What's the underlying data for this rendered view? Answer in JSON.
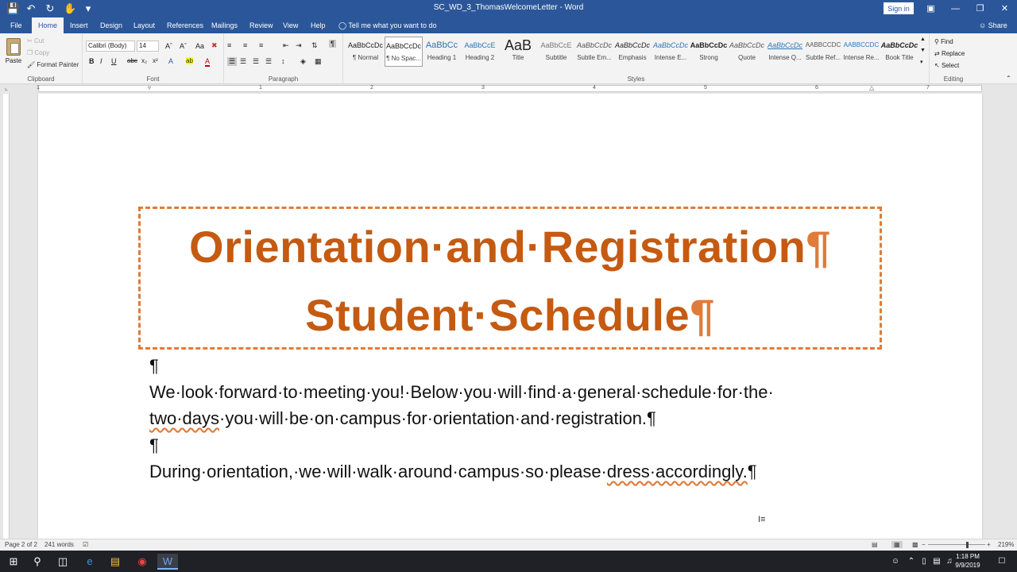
{
  "window": {
    "title": "SC_WD_3_ThomasWelcomeLetter - Word",
    "signin_label": "Sign in",
    "qat_icons": [
      "save-icon",
      "undo-icon",
      "redo-icon",
      "touch-mode-icon",
      "customize-qat-icon"
    ],
    "controls": [
      "ribbon-display-icon",
      "minimize-icon",
      "restore-icon",
      "close-icon"
    ]
  },
  "tabs": [
    "File",
    "Home",
    "Insert",
    "Design",
    "Layout",
    "References",
    "Mailings",
    "Review",
    "View",
    "Help"
  ],
  "active_tab": "Home",
  "tell_me": "Tell me what you want to do",
  "share_label": "Share",
  "ribbon": {
    "clipboard": {
      "label": "Clipboard",
      "paste": "Paste",
      "cut": "Cut",
      "copy": "Copy",
      "format_painter": "Format Painter"
    },
    "font": {
      "label": "Font",
      "font_name": "Calibri (Body)",
      "font_size": "14",
      "format_buttons": [
        "B",
        "I",
        "U"
      ]
    },
    "paragraph": {
      "label": "Paragraph"
    },
    "styles": {
      "label": "Styles",
      "items": [
        {
          "preview": "AaBbCcDc",
          "name": "¶ Normal"
        },
        {
          "preview": "AaBbCcDc",
          "name": "¶ No Spac..."
        },
        {
          "preview": "AaBbCc",
          "name": "Heading 1"
        },
        {
          "preview": "AaBbCcE",
          "name": "Heading 2"
        },
        {
          "preview": "AaB",
          "name": "Title"
        },
        {
          "preview": "AaBbCcE",
          "name": "Subtitle"
        },
        {
          "preview": "AaBbCcDc",
          "name": "Subtle Em..."
        },
        {
          "preview": "AaBbCcDc",
          "name": "Emphasis"
        },
        {
          "preview": "AaBbCcDc",
          "name": "Intense E..."
        },
        {
          "preview": "AaBbCcDc",
          "name": "Strong"
        },
        {
          "preview": "AaBbCcDc",
          "name": "Quote"
        },
        {
          "preview": "AaBbCcDc",
          "name": "Intense Q..."
        },
        {
          "preview": "AABBCCDC",
          "name": "Subtle Ref..."
        },
        {
          "preview": "AABBCCDC",
          "name": "Intense Re..."
        },
        {
          "preview": "AaBbCcDc",
          "name": "Book Title"
        }
      ]
    },
    "editing": {
      "label": "Editing",
      "find": "Find",
      "replace": "Replace",
      "select": "Select"
    }
  },
  "ruler_numbers": [
    "1",
    "1",
    "2",
    "3",
    "4",
    "5",
    "6",
    "7"
  ],
  "document": {
    "heading_line1": "Orientation·and·Registration",
    "heading_line2": "Student·Schedule",
    "pilcrow": "¶",
    "para1_line1": "We·look·forward·to·meeting·you!·Below·you·will·find·a·general·schedule·for·the·",
    "para1_line2_marked": "two·days",
    "para1_line2_rest": "·you·will·be·on·campus·for·orientation·and·registration.",
    "para2_start": "During·orientation,·we·will·walk·around·campus·so·please·",
    "para2_marked": "dress·accordingly.",
    "accent_color": "#c55a11",
    "border_color": "#e07b39"
  },
  "statusbar": {
    "page": "Page 2 of 2",
    "words": "241 words",
    "zoom": "219%"
  },
  "taskbar": {
    "time": "1:18 PM",
    "date": "9/9/2019"
  }
}
